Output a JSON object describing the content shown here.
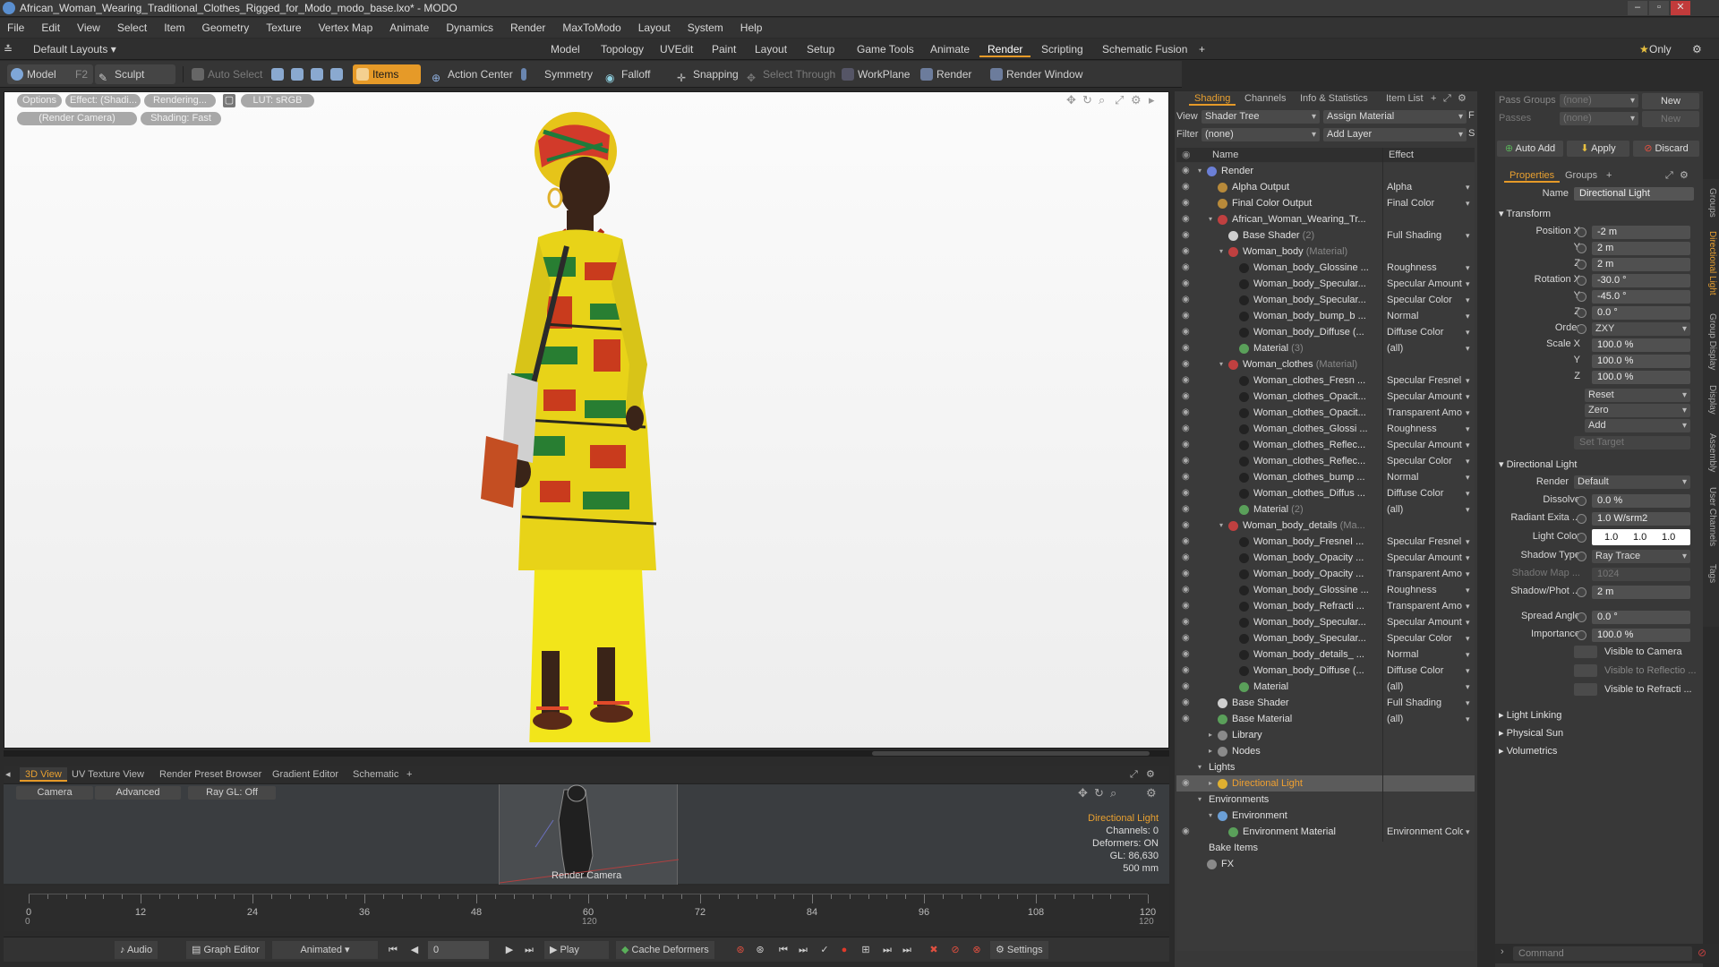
{
  "window": {
    "title": "African_Woman_Wearing_Traditional_Clothes_Rigged_for_Modo_modo_base.lxo* - MODO"
  },
  "menu": [
    "File",
    "Edit",
    "View",
    "Select",
    "Item",
    "Geometry",
    "Texture",
    "Vertex Map",
    "Animate",
    "Dynamics",
    "Render",
    "MaxToModo",
    "Layout",
    "System",
    "Help"
  ],
  "layoutbar": {
    "layout_name": "Default Layouts",
    "tabs": [
      "Model",
      "Topology",
      "UVEdit",
      "Paint",
      "Layout",
      "Setup",
      "Game Tools",
      "Animate",
      "Render",
      "Scripting",
      "Schematic Fusion"
    ],
    "active_tab": "Render",
    "plus": "+",
    "only_label": "Only"
  },
  "toolbar": {
    "model": "Model",
    "f2": "F2",
    "sculpt": "Sculpt",
    "auto_select": "Auto Select",
    "items": "Items",
    "action_center": "Action Center",
    "symmetry": "Symmetry",
    "falloff": "Falloff",
    "snapping": "Snapping",
    "select_through": "Select Through",
    "workplane": "WorkPlane",
    "render": "Render",
    "render_window": "Render Window"
  },
  "viewport": {
    "options": "Options",
    "effect": "Effect: (Shadi...",
    "rendering": "Rendering...",
    "lut": "LUT: sRGB",
    "camera": "(Render Camera)",
    "shading": "Shading: Fast"
  },
  "bottom_tabs": [
    "3D View",
    "UV Texture View",
    "Render Preset Browser",
    "Gradient Editor",
    "Schematic",
    "+"
  ],
  "view3d": {
    "camera": "Camera",
    "advanced": "Advanced",
    "raygl": "Ray GL: Off",
    "render_camera": "Render Camera",
    "info": [
      "Directional Light",
      "Channels: 0",
      "Deformers: ON",
      "GL: 86,630",
      "500 mm"
    ]
  },
  "timeline": {
    "ticks": [
      "0",
      "12",
      "24",
      "36",
      "48",
      "60",
      "72",
      "84",
      "96",
      "108",
      "120"
    ],
    "sub_left": "0",
    "sub_mid": "120",
    "sub_right": "120"
  },
  "transport": {
    "audio": "Audio",
    "graph_editor": "Graph Editor",
    "animated": "Animated",
    "frame": "0",
    "play": "Play",
    "cache_deformers": "Cache Deformers",
    "settings": "Settings"
  },
  "shading": {
    "tabs": [
      "Shading",
      "Channels",
      "Info & Statistics",
      "Item List",
      "+"
    ],
    "view_label": "View",
    "view_value": "Shader Tree",
    "assign_material": "Assign Material",
    "f": "F",
    "filter_label": "Filter",
    "filter_value": "(none)",
    "add_layer": "Add Layer",
    "s": "S",
    "col_name": "Name",
    "col_effect": "Effect",
    "rows": [
      {
        "name": "Render",
        "effect": "",
        "indent": 0,
        "exp": "▾",
        "sw": "#6b7fd6"
      },
      {
        "name": "Alpha Output",
        "effect": "Alpha",
        "indent": 1,
        "sw": "#b88a3a"
      },
      {
        "name": "Final Color Output",
        "effect": "Final Color",
        "indent": 1,
        "sw": "#b88a3a"
      },
      {
        "name": "African_Woman_Wearing_Tr...",
        "effect": "",
        "indent": 1,
        "exp": "▾",
        "sw": "#c04040"
      },
      {
        "name": "Base Shader",
        "suffix": " (2)",
        "effect": "Full Shading",
        "indent": 2,
        "sw": "#cfcfcf"
      },
      {
        "name": "Woman_body",
        "suffix": " (Material)",
        "effect": "",
        "indent": 2,
        "exp": "▾",
        "sw": "#c04040"
      },
      {
        "name": "Woman_body_Glossine ...",
        "effect": "Roughness",
        "indent": 3,
        "sw": "#222"
      },
      {
        "name": "Woman_body_Specular...",
        "effect": "Specular Amount",
        "indent": 3,
        "sw": "#222"
      },
      {
        "name": "Woman_body_Specular...",
        "effect": "Specular Color",
        "indent": 3,
        "sw": "#222"
      },
      {
        "name": "Woman_body_bump_b ...",
        "effect": "Normal",
        "indent": 3,
        "sw": "#222"
      },
      {
        "name": "Woman_body_Diffuse (...",
        "effect": "Diffuse Color",
        "indent": 3,
        "sw": "#222"
      },
      {
        "name": "Material",
        "suffix": " (3)",
        "effect": "(all)",
        "indent": 3,
        "sw": "#5aa05a"
      },
      {
        "name": "Woman_clothes",
        "suffix": " (Material)",
        "effect": "",
        "indent": 2,
        "exp": "▾",
        "sw": "#c04040"
      },
      {
        "name": "Woman_clothes_Fresn ...",
        "effect": "Specular Fresnel",
        "indent": 3,
        "sw": "#222"
      },
      {
        "name": "Woman_clothes_Opacit...",
        "effect": "Specular Amount",
        "indent": 3,
        "sw": "#222"
      },
      {
        "name": "Woman_clothes_Opacit...",
        "effect": "Transparent Amo...",
        "indent": 3,
        "sw": "#222"
      },
      {
        "name": "Woman_clothes_Glossi ...",
        "effect": "Roughness",
        "indent": 3,
        "sw": "#222"
      },
      {
        "name": "Woman_clothes_Reflec...",
        "effect": "Specular Amount",
        "indent": 3,
        "sw": "#222"
      },
      {
        "name": "Woman_clothes_Reflec...",
        "effect": "Specular Color",
        "indent": 3,
        "sw": "#222"
      },
      {
        "name": "Woman_clothes_bump ...",
        "effect": "Normal",
        "indent": 3,
        "sw": "#222"
      },
      {
        "name": "Woman_clothes_Diffus ...",
        "effect": "Diffuse Color",
        "indent": 3,
        "sw": "#222"
      },
      {
        "name": "Material",
        "suffix": " (2)",
        "effect": "(all)",
        "indent": 3,
        "sw": "#5aa05a"
      },
      {
        "name": "Woman_body_details",
        "suffix": " (Ma...",
        "effect": "",
        "indent": 2,
        "exp": "▾",
        "sw": "#c04040"
      },
      {
        "name": "Woman_body_FresneI ...",
        "effect": "Specular Fresnel",
        "indent": 3,
        "sw": "#222"
      },
      {
        "name": "Woman_body_Opacity ...",
        "effect": "Specular Amount",
        "indent": 3,
        "sw": "#222"
      },
      {
        "name": "Woman_body_Opacity ...",
        "effect": "Transparent Amo...",
        "indent": 3,
        "sw": "#222"
      },
      {
        "name": "Woman_body_Glossine ...",
        "effect": "Roughness",
        "indent": 3,
        "sw": "#222"
      },
      {
        "name": "Woman_body_Refracti ...",
        "effect": "Transparent Amo...",
        "indent": 3,
        "sw": "#222"
      },
      {
        "name": "Woman_body_Specular...",
        "effect": "Specular Amount",
        "indent": 3,
        "sw": "#222"
      },
      {
        "name": "Woman_body_Specular...",
        "effect": "Specular Color",
        "indent": 3,
        "sw": "#222"
      },
      {
        "name": "Woman_body_details_ ...",
        "effect": "Normal",
        "indent": 3,
        "sw": "#222"
      },
      {
        "name": "Woman_body_Diffuse (...",
        "effect": "Diffuse Color",
        "indent": 3,
        "sw": "#222"
      },
      {
        "name": "Material",
        "effect": "(all)",
        "indent": 3,
        "sw": "#5aa05a"
      },
      {
        "name": "Base Shader",
        "effect": "Full Shading",
        "indent": 1,
        "sw": "#cfcfcf"
      },
      {
        "name": "Base Material",
        "effect": "(all)",
        "indent": 1,
        "sw": "#5aa05a"
      },
      {
        "name": "Library",
        "effect": "",
        "indent": 1,
        "exp": "▸",
        "noeye": true,
        "sw": "#8a8a8a"
      },
      {
        "name": "Nodes",
        "effect": "",
        "indent": 1,
        "exp": "▸",
        "noeye": true,
        "sw": "#8a8a8a"
      },
      {
        "name": "Lights",
        "effect": "",
        "indent": 0,
        "exp": "▾",
        "noeye": true
      },
      {
        "name": "Directional Light",
        "effect": "",
        "indent": 1,
        "exp": "▸",
        "sw": "#e0b030",
        "sel": true
      },
      {
        "name": "Environments",
        "effect": "",
        "indent": 0,
        "exp": "▾",
        "noeye": true
      },
      {
        "name": "Environment",
        "effect": "",
        "indent": 1,
        "exp": "▾",
        "noeye": true,
        "sw": "#6b9fd6"
      },
      {
        "name": "Environment Material",
        "effect": "Environment Color",
        "indent": 2,
        "sw": "#5aa05a"
      },
      {
        "name": "Bake Items",
        "effect": "",
        "indent": 0,
        "noeye": true
      },
      {
        "name": "FX",
        "effect": "",
        "indent": 0,
        "noeye": true,
        "sw": "#8a8a8a"
      }
    ]
  },
  "props": {
    "pass_groups_label": "Pass Groups",
    "pass_groups_value": "(none)",
    "new1": "New",
    "passes_label": "Passes",
    "passes_value": "(none)",
    "new2": "New",
    "auto_add": "Auto Add",
    "apply": "Apply",
    "discard": "Discard",
    "tab_properties": "Properties",
    "tab_groups": "Groups",
    "plus": "+",
    "name_label": "Name",
    "name_value": "Directional Light",
    "transform": "Transform",
    "position_x_label": "Position X",
    "position_x": "-2 m",
    "y_label": "Y",
    "position_y": "2 m",
    "z_label": "Z",
    "position_z": "2 m",
    "rotation_x_label": "Rotation X",
    "rotation_x": "-30.0 °",
    "rotation_y": "-45.0 °",
    "rotation_z": "0.0 °",
    "order_label": "Order",
    "order_value": "ZXY",
    "scale_x_label": "Scale X",
    "scale_x": "100.0 %",
    "scale_y": "100.0 %",
    "scale_z": "100.0 %",
    "reset": "Reset",
    "zero": "Zero",
    "add": "Add",
    "set_target": "Set Target",
    "directional_light": "Directional Light",
    "render_label": "Render",
    "render_value": "Default",
    "dissolve_label": "Dissolve",
    "dissolve_value": "0.0 %",
    "radiant_label": "Radiant Exita ...",
    "radiant_value": "1.0 W/srm2",
    "light_color_label": "Light Color",
    "light_color": [
      "1.0",
      "1.0",
      "1.0"
    ],
    "shadow_type_label": "Shadow Type",
    "shadow_type": "Ray Trace",
    "shadow_map_label": "Shadow Map ...",
    "shadow_map": "1024",
    "shadow_phot_label": "Shadow/Phot ...",
    "shadow_phot": "2 m",
    "spread_label": "Spread Angle",
    "spread_value": "0.0 °",
    "importance_label": "Importance",
    "importance_value": "100.0 %",
    "vis_camera": "Visible to Camera",
    "vis_reflection": "Visible to Reflectio ...",
    "vis_refraction": "Visible to Refracti ...",
    "light_linking": "Light Linking",
    "physical_sun": "Physical Sun",
    "volumetrics": "Volumetrics",
    "command": "Command",
    "side_tabs": [
      "Groups",
      "Directional Light",
      "Group Display",
      "Display",
      "Assembly",
      "User Channels",
      "Tags"
    ]
  },
  "colors": {
    "accent": "#e69a28",
    "panel": "#383838",
    "viewport_bg": "#f4f4f4",
    "dress_yellow": "#f0e41a"
  }
}
